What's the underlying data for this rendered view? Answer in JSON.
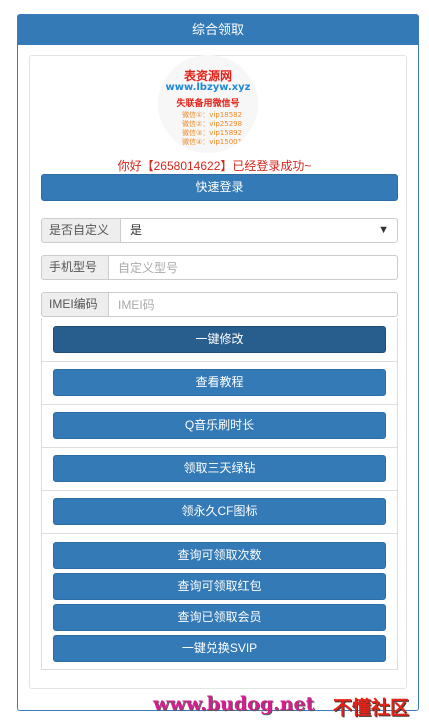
{
  "header": {
    "title": "综合领取"
  },
  "avatar": {
    "line1": "表资源网",
    "line2": "www.lbzyw.xyz",
    "line3": "失联备用微信号",
    "contacts": [
      "微信①：vip18582",
      "微信②：vip25298",
      "微信③：vip15892",
      "微信④：vip15001"
    ]
  },
  "welcome": "你好【2658014622】已经登录成功~",
  "login_button": "快速登录",
  "form": {
    "custom": {
      "label": "是否自定义",
      "value": "是",
      "caret": "▼"
    },
    "model": {
      "label": "手机型号",
      "placeholder": "自定义型号"
    },
    "imei": {
      "label": "IMEI编码",
      "placeholder": "IMEI码"
    }
  },
  "actions": [
    "一键修改",
    "查看教程",
    "Q音乐刷时长",
    "领取三天绿钻",
    "领永久CF图标",
    "查询可领取次数",
    "查询可领取红包",
    "查询已领取会员",
    "一键兑换SVIP"
  ],
  "watermark": {
    "url": "www.budog.net",
    "name": "不懂社区"
  },
  "colors": {
    "primary": "#337ab7",
    "active": "#285e8e",
    "welcome": "#d9261c"
  }
}
